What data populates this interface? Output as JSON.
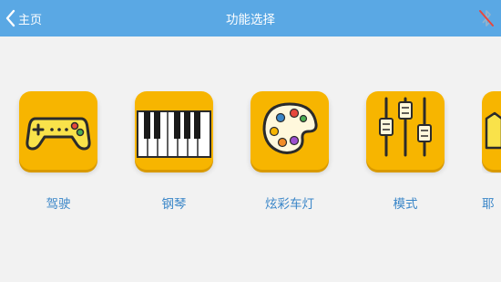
{
  "header": {
    "back_label": "主页",
    "title": "功能选择",
    "bluetooth_icon": "bluetooth-disabled-icon"
  },
  "colors": {
    "header_bg": "#5aa8e4",
    "tile_bg": "#f7b500",
    "label_text": "#3a86c8",
    "page_bg": "#f2f2f2"
  },
  "tiles": [
    {
      "label": "驾驶",
      "icon": "gamepad-icon"
    },
    {
      "label": "钢琴",
      "icon": "piano-keys-icon"
    },
    {
      "label": "炫彩车灯",
      "icon": "color-palette-icon"
    },
    {
      "label": "模式",
      "icon": "sliders-icon"
    },
    {
      "label": "耶",
      "icon": "partial-tile-icon"
    }
  ]
}
